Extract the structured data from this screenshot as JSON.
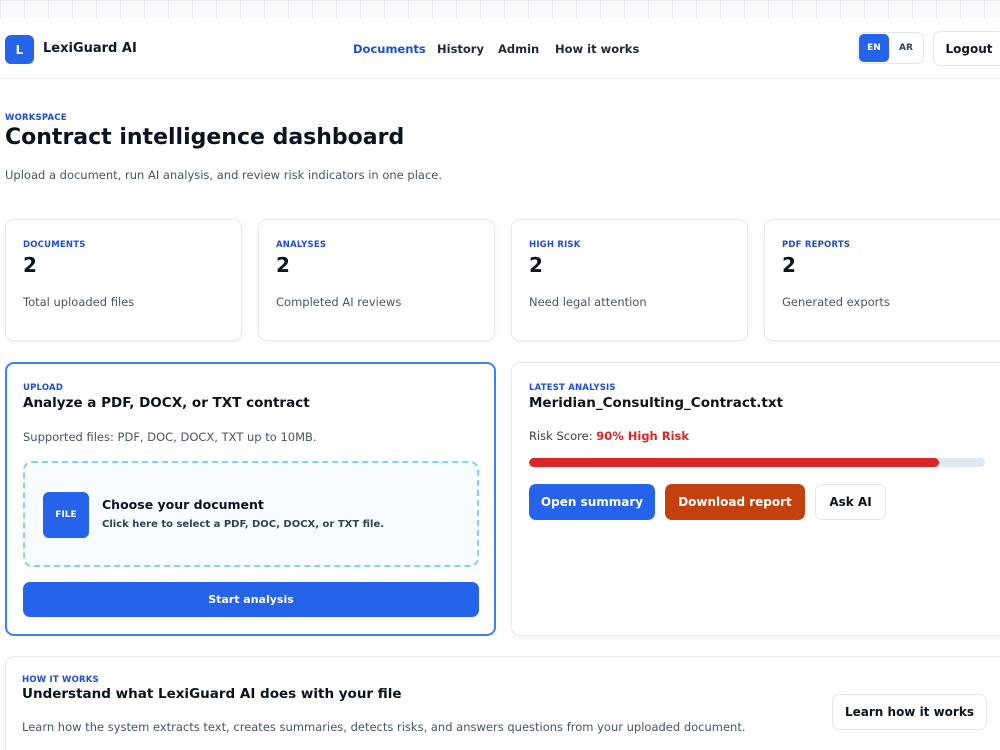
{
  "header": {
    "logo_letter": "L",
    "brand": "LexiGuard AI",
    "nav": [
      "Documents",
      "History",
      "Admin",
      "How it works"
    ],
    "active_nav": "Documents",
    "languages": [
      "EN",
      "AR"
    ],
    "active_language": "EN",
    "logout_label": "Logout"
  },
  "workspace": {
    "eyebrow": "WORKSPACE",
    "title": "Contract intelligence dashboard",
    "subtitle": "Upload a document, run AI analysis, and review risk indicators in one place."
  },
  "stats": [
    {
      "label": "DOCUMENTS",
      "value": "2",
      "desc": "Total uploaded files"
    },
    {
      "label": "ANALYSES",
      "value": "2",
      "desc": "Completed AI reviews"
    },
    {
      "label": "HIGH RISK",
      "value": "2",
      "desc": "Need legal attention"
    },
    {
      "label": "PDF REPORTS",
      "value": "2",
      "desc": "Generated exports"
    }
  ],
  "upload": {
    "eyebrow": "UPLOAD",
    "title": "Analyze a PDF, DOCX, or TXT contract",
    "subtitle": "Supported files: PDF, DOC, DOCX, TXT up to 10MB.",
    "file_badge": "FILE",
    "dropzone_title": "Choose your document",
    "dropzone_sub": "Click here to select a PDF, DOC, DOCX, or TXT file.",
    "start_label": "Start analysis"
  },
  "latest": {
    "eyebrow": "LATEST ANALYSIS",
    "filename": "Meridian_Consulting_Contract.txt",
    "risk_label": "Risk Score:",
    "risk_value": "90% High Risk",
    "risk_percent": 90,
    "buttons": {
      "summary": "Open summary",
      "download": "Download report",
      "ask": "Ask AI"
    }
  },
  "how": {
    "eyebrow": "HOW IT WORKS",
    "title": "Understand what LexiGuard AI does with your file",
    "subtitle": "Learn how the system extracts text, creates summaries, detects risks, and answers questions from your uploaded document.",
    "button": "Learn how it works"
  },
  "colors": {
    "primary": "#2563eb",
    "accent_text": "#1d4ed8",
    "danger": "#dc2626",
    "warning": "#c2410c"
  }
}
